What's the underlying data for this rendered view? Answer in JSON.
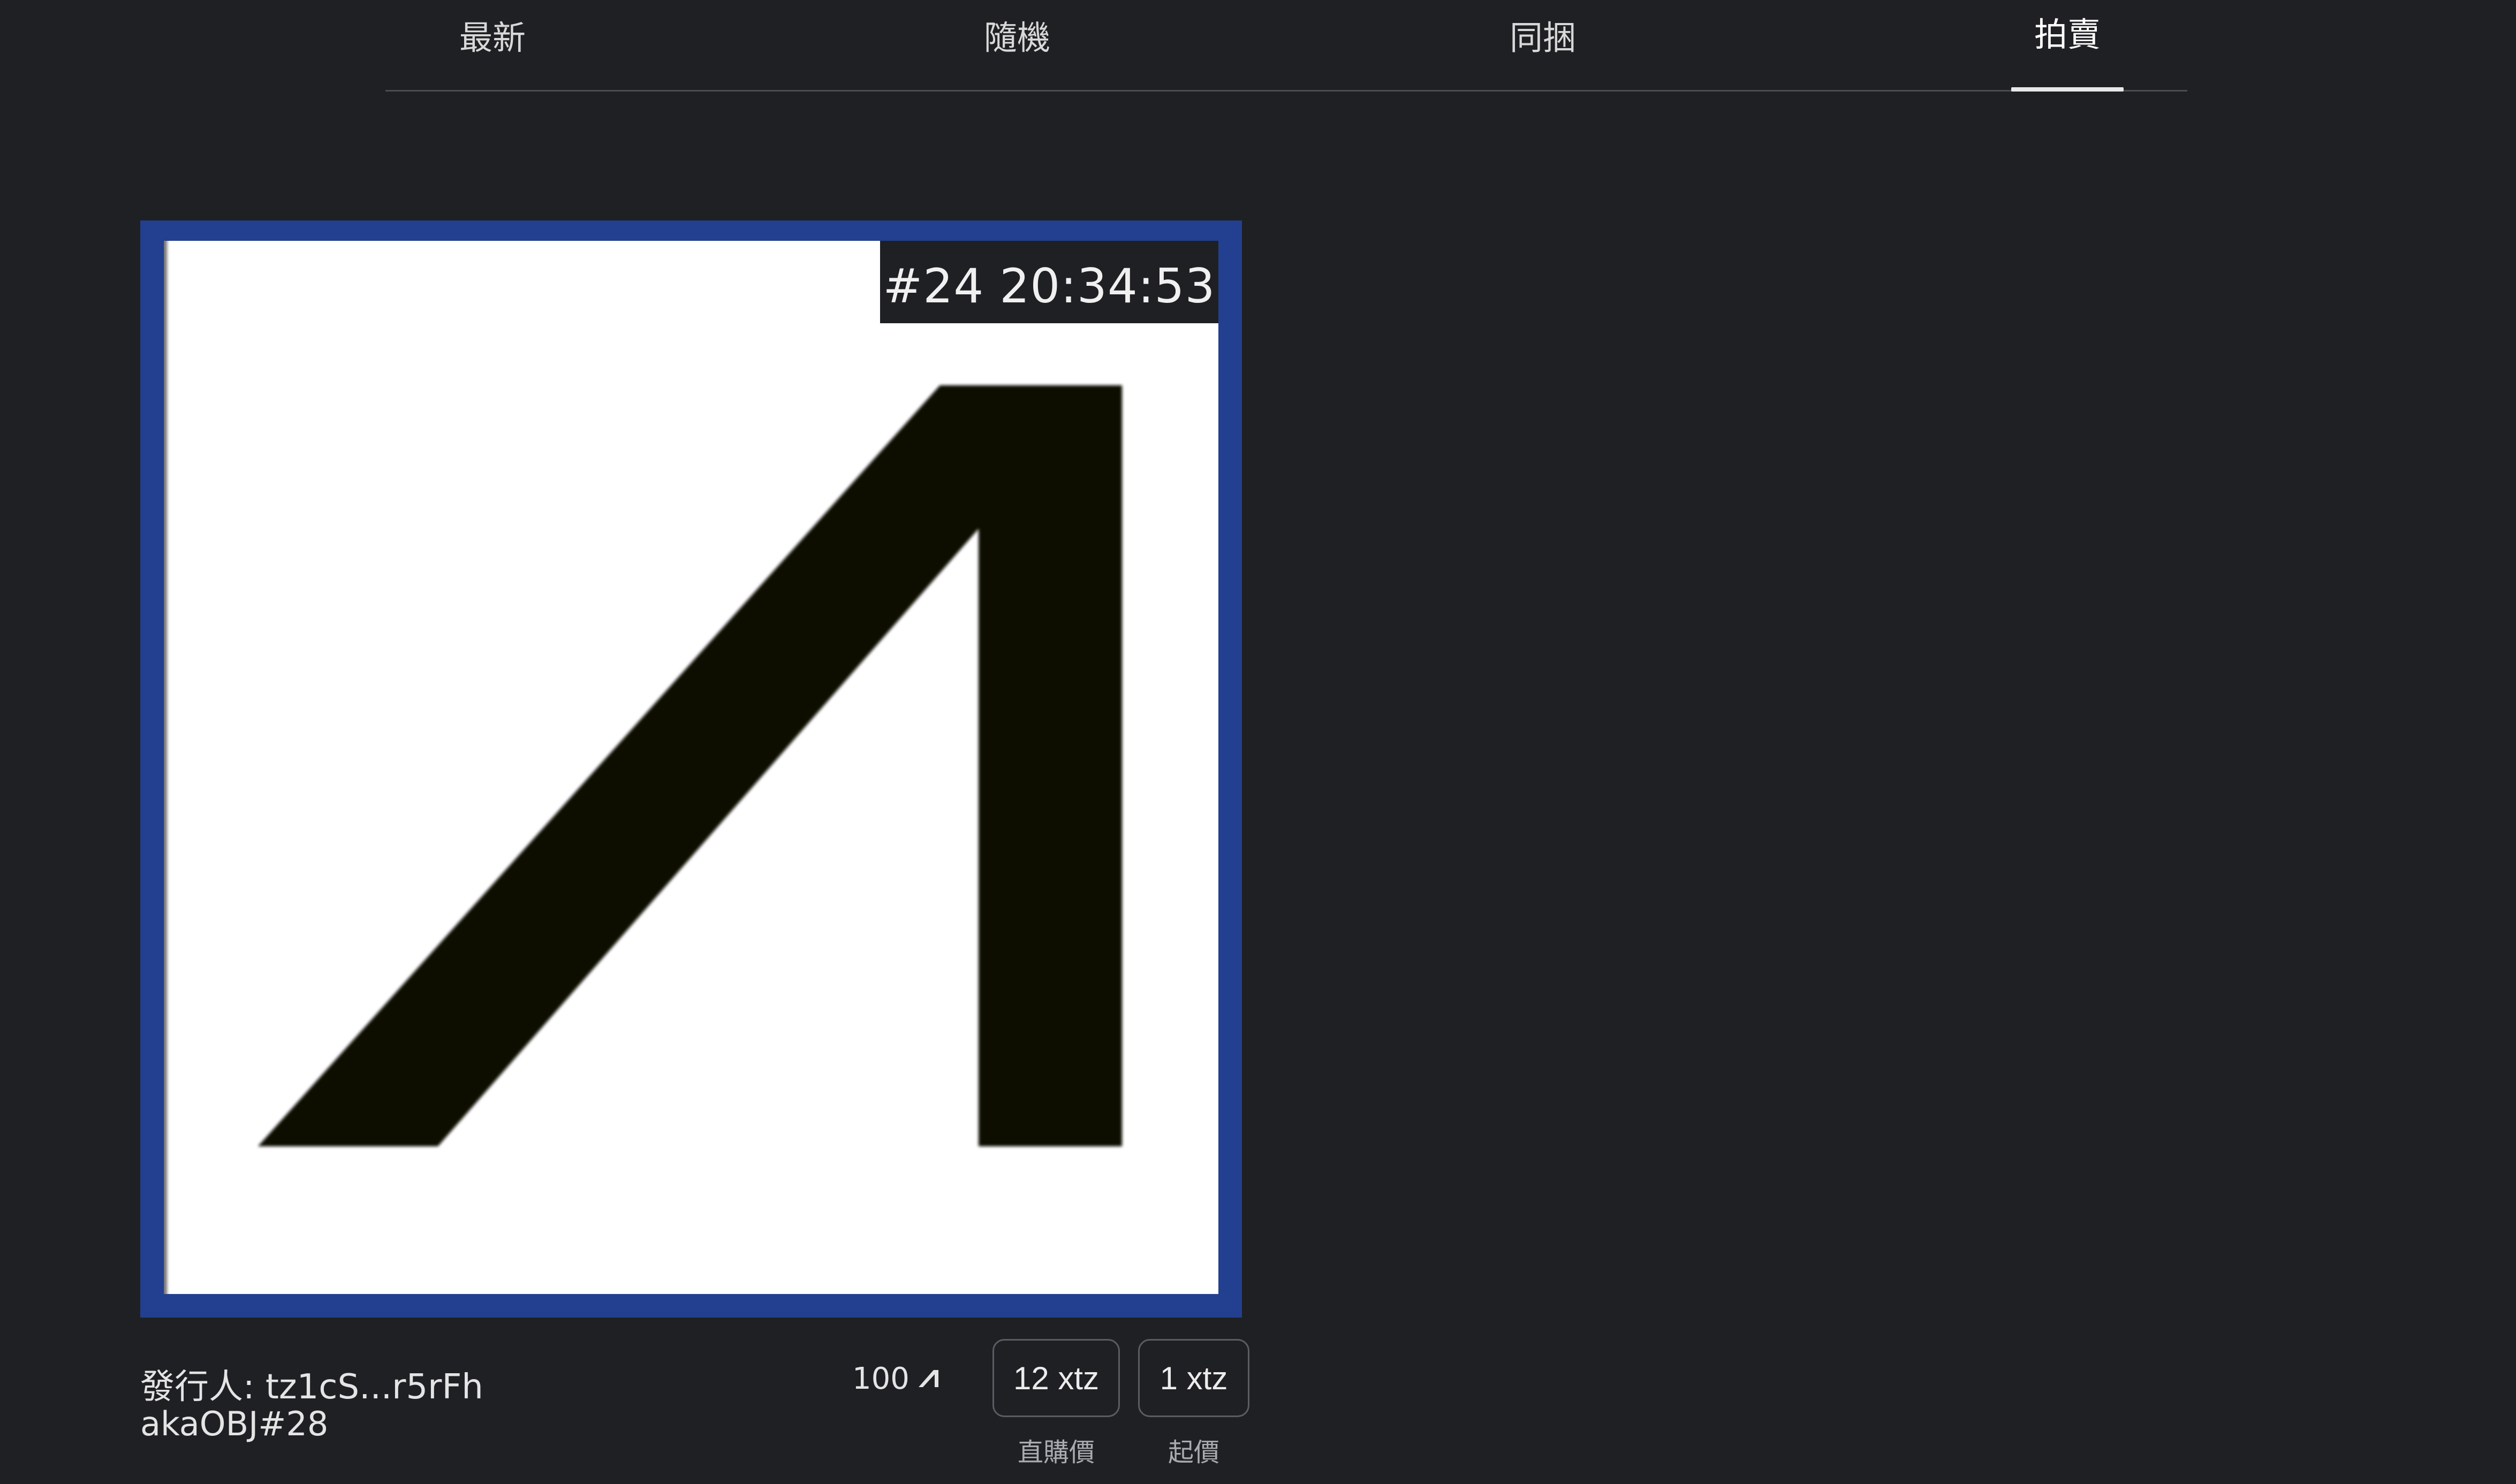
{
  "tabs": [
    {
      "label": "最新",
      "active": false
    },
    {
      "label": "隨機",
      "active": false
    },
    {
      "label": "同捆",
      "active": false
    },
    {
      "label": "拍賣",
      "active": true
    }
  ],
  "card": {
    "badge_text": "#24 20:34:53",
    "artwork_icon": "akaswap-lambda-logo",
    "frame_color": "#233f8f",
    "issuer_text": "發行人: tz1cS...r5rFh",
    "object_name": "akaOBJ#28",
    "edition_count": "100",
    "edition_icon": "akaswap-logo-icon",
    "buy_price": "12 xtz",
    "buy_caption": "直購價",
    "start_price": "1 xtz",
    "start_caption": "起價"
  }
}
